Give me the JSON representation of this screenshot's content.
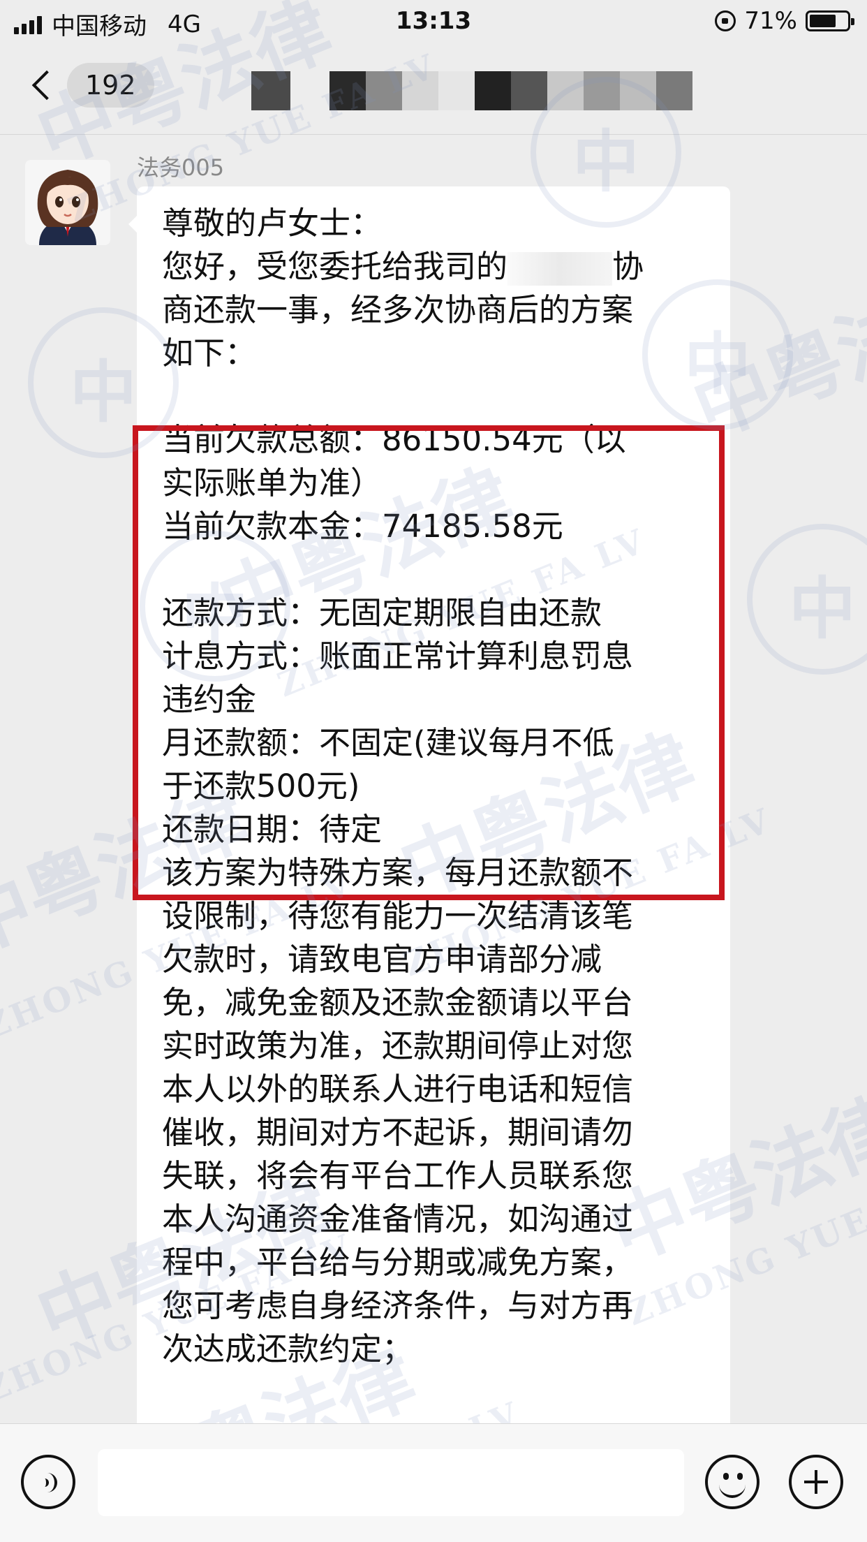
{
  "status_bar": {
    "carrier": "中国移动",
    "network": "4G",
    "time": "13:13",
    "battery_percent": "71%",
    "battery_level": 0.71
  },
  "nav": {
    "back_count": "192"
  },
  "message": {
    "sender": "法务005",
    "lines": [
      "尊敬的卢女士：",
      "您好，受您委托给我司的",
      "协",
      "商还款一事，经多次协商后的方案",
      "如下：",
      "当前欠款总额：86150.54元（以",
      "实际账单为准）",
      "当前欠款本金：74185.58元",
      "还款方式：无固定期限自由还款",
      "计息方式：账面正常计算利息罚息",
      "违约金",
      "月还款额：不固定(建议每月不低",
      "于还款500元)",
      "还款日期：待定",
      "该方案为特殊方案，每月还款额不",
      "设限制，待您有能力一次结清该笔",
      "欠款时，请致电官方申请部分减",
      "免，减免金额及还款金额请以平台",
      "实时政策为准，还款期间停止对您",
      "本人以外的联系人进行电话和短信",
      "催收，期间对方不起诉，期间请勿",
      "失联，将会有平台工作人员联系您",
      "本人沟通资金准备情况，如沟通过",
      "程中，平台给与分期或减免方案，",
      "您可考虑自身经济条件，与对方再",
      "次达成还款约定；"
    ]
  },
  "watermark": {
    "cn": "中粤法律",
    "en": "ZHONG YUE FA LV"
  },
  "colors": {
    "highlight_border": "#c8161e",
    "bubble": "#ffffff",
    "background": "#ededed"
  }
}
